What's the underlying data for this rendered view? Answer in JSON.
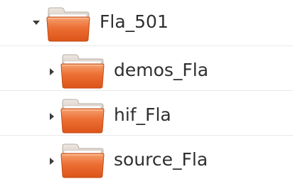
{
  "file_tree": {
    "items": [
      {
        "label": "Fla_501",
        "expanded": true,
        "icon": "folder-icon"
      },
      {
        "label": "demos_Fla",
        "expanded": false,
        "icon": "folder-icon"
      },
      {
        "label": "hif_Fla",
        "expanded": false,
        "icon": "folder-icon"
      },
      {
        "label": "source_Fla",
        "expanded": false,
        "icon": "folder-icon"
      }
    ]
  },
  "colors": {
    "folder_orange": "#e8612b",
    "folder_light": "#f39a6a",
    "folder_tab": "#d8d2cc",
    "expander": "#3c3c3c",
    "text": "#2f2f2f",
    "divider": "#e9e9e9"
  }
}
